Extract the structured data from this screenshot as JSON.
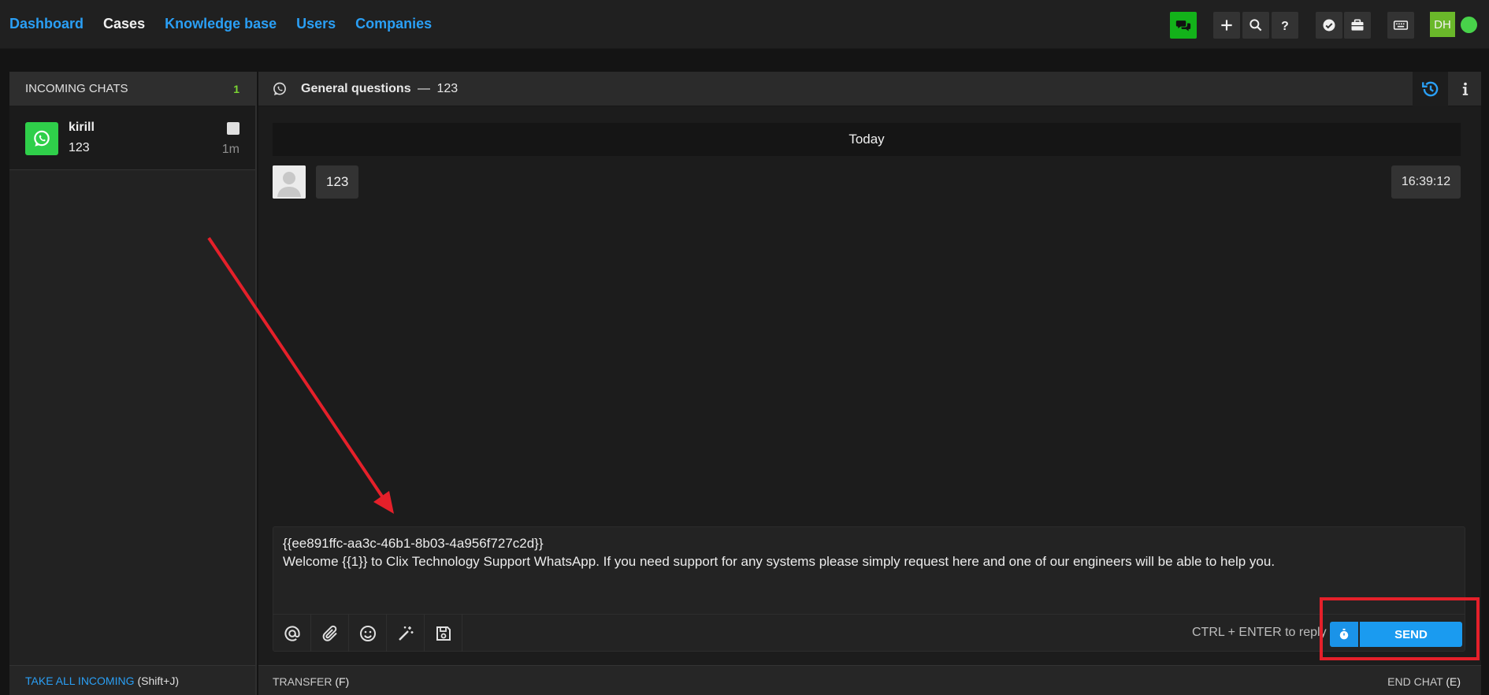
{
  "nav": {
    "dashboard": "Dashboard",
    "cases": "Cases",
    "knowledge_base": "Knowledge base",
    "users": "Users",
    "companies": "Companies"
  },
  "toolbar": {
    "user_initials": "DH",
    "icons": [
      "chat-icon",
      "plus-icon",
      "search-icon",
      "help-icon",
      "check-badge-icon",
      "briefcase-icon",
      "keyboard-icon"
    ]
  },
  "incoming": {
    "title": "INCOMING CHATS",
    "count": "1",
    "chats": [
      {
        "name": "kirill",
        "message": "123",
        "time": "1m"
      }
    ],
    "take_all_label": "TAKE ALL INCOMING",
    "take_all_shortcut": "(Shift+J)"
  },
  "conversation": {
    "channel": "General questions",
    "separator": "—",
    "subject": "123",
    "date_divider": "Today",
    "messages": [
      {
        "text": "123",
        "time": "16:39:12"
      }
    ]
  },
  "composer": {
    "line1": "{{ee891ffc-aa3c-46b1-8b03-4a956f727c2d}}",
    "line2": "Welcome {{1}} to Clix Technology Support WhatsApp. If you need support for any systems please simply request here and one of our engineers will be able to help you.",
    "reply_hint": "CTRL + ENTER to reply",
    "send_label": "SEND"
  },
  "footer": {
    "transfer_label": "TRANSFER",
    "transfer_key": "(F)",
    "end_label": "END CHAT",
    "end_key": "(E)"
  },
  "colors": {
    "accent": "#2a9ff5",
    "send": "#1a9bf0",
    "whatsapp": "#2fcf4a",
    "online": "#48d24a",
    "annotation": "#e5202a"
  }
}
